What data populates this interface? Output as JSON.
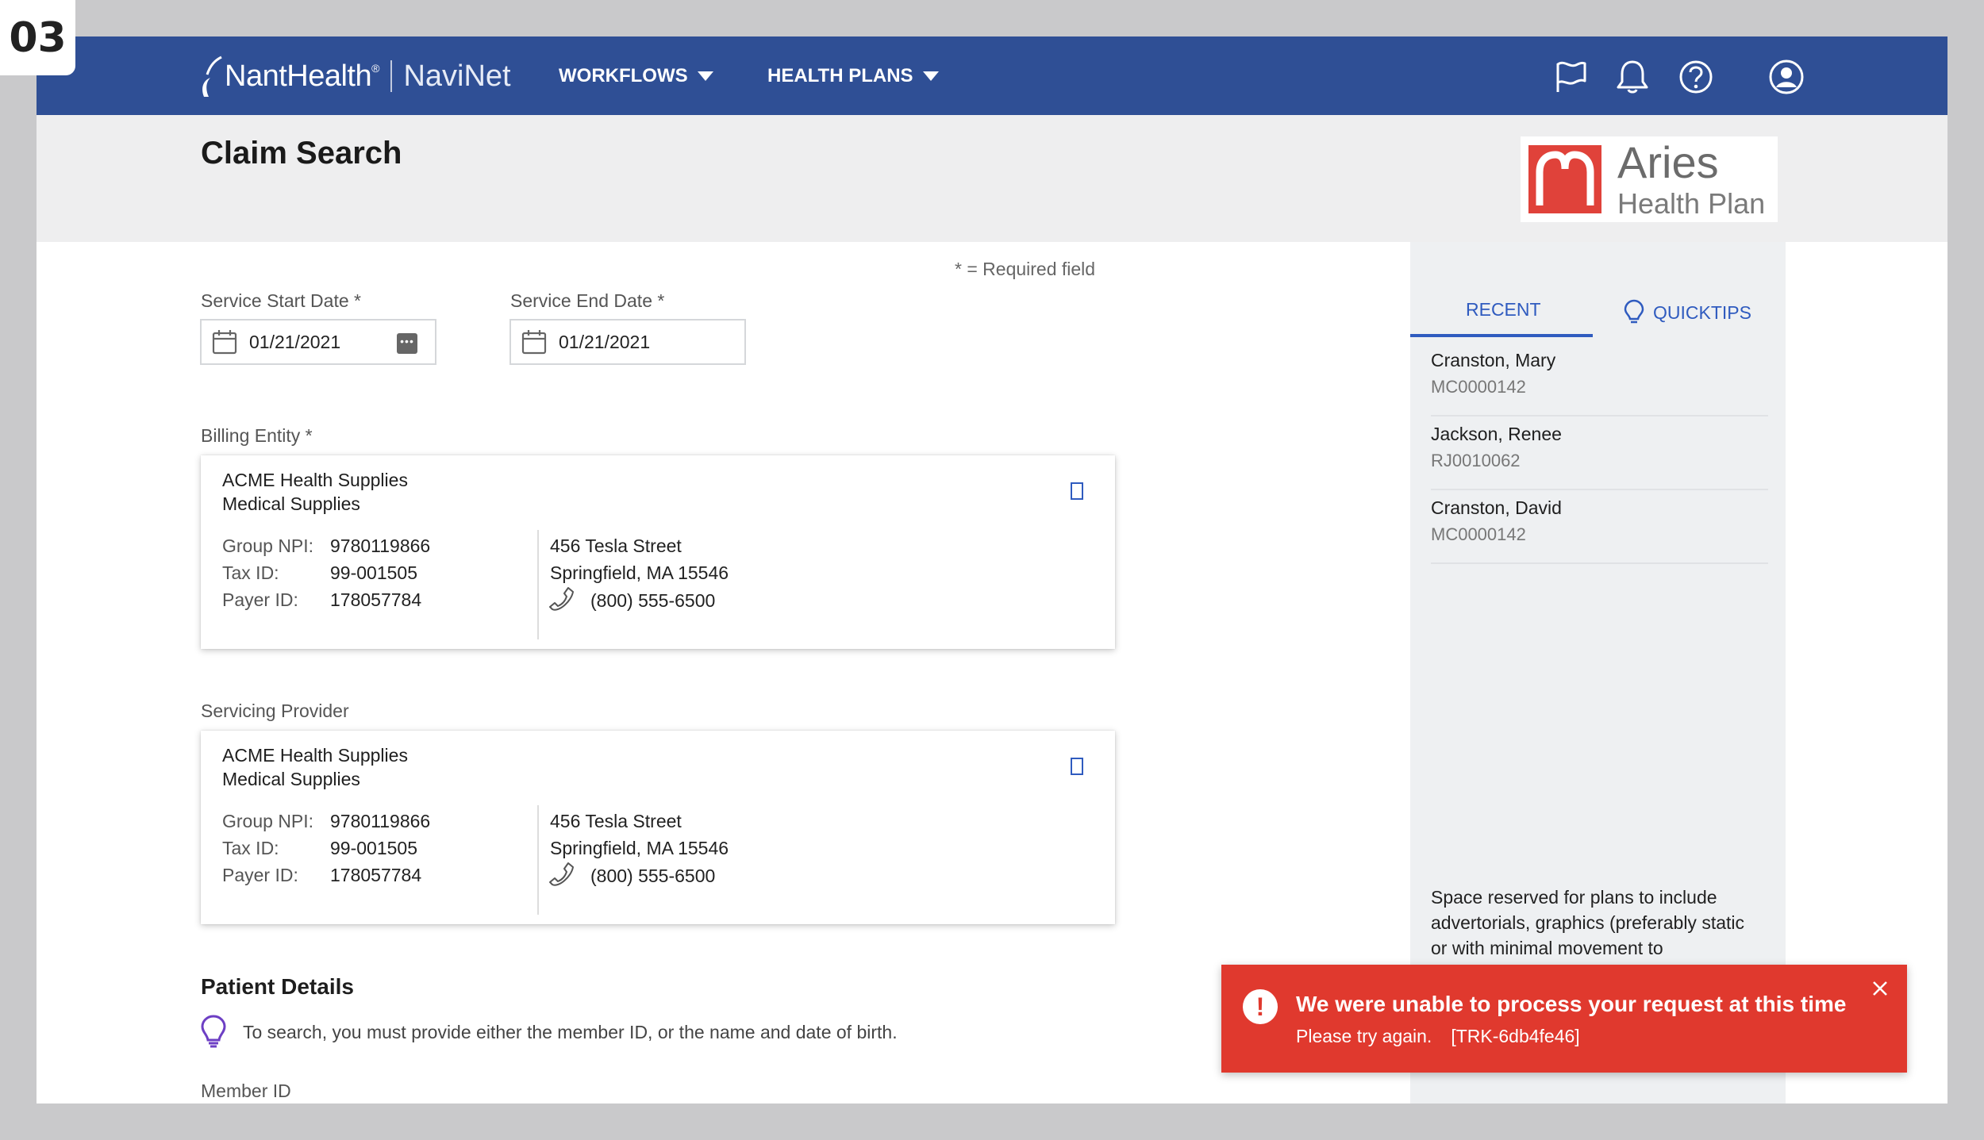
{
  "step_badge": "03",
  "header": {
    "brand": "NantHealth",
    "product": "NaviNet",
    "nav": [
      {
        "label": "WORKFLOWS"
      },
      {
        "label": "HEALTH PLANS"
      }
    ],
    "icons": [
      "flag-icon",
      "bell-icon",
      "help-icon",
      "user-icon"
    ],
    "bg_color": "#2f4f95"
  },
  "page": {
    "title": "Claim Search",
    "required_note": "* = Required field"
  },
  "plan_logo": {
    "name": "Aries",
    "subtitle": "Health Plan",
    "mark_color": "#e0423a"
  },
  "form": {
    "start_date": {
      "label": "Service Start Date *",
      "value": "01/21/2021"
    },
    "end_date": {
      "label": "Service End Date *",
      "value": "01/21/2021"
    },
    "billing_entity": {
      "label": "Billing Entity *",
      "name_line1": "ACME Health Supplies",
      "name_line2": "Medical Supplies",
      "group_npi_label": "Group NPI:",
      "group_npi": "9780119866",
      "tax_id_label": "Tax ID:",
      "tax_id": "99-001505",
      "payer_id_label": "Payer ID:",
      "payer_id": "178057784",
      "street": "456 Tesla Street",
      "city": "Springfield, MA 15546",
      "phone": "(800) 555-6500"
    },
    "servicing_provider": {
      "label": "Servicing Provider",
      "name_line1": "ACME Health Supplies",
      "name_line2": "Medical Supplies",
      "group_npi_label": "Group NPI:",
      "group_npi": "9780119866",
      "tax_id_label": "Tax ID:",
      "tax_id": "99-001505",
      "payer_id_label": "Payer ID:",
      "payer_id": "178057784",
      "street": "456 Tesla Street",
      "city": "Springfield, MA 15546",
      "phone": "(800) 555-6500"
    },
    "patient_details": {
      "title": "Patient Details",
      "hint": "To search, you must provide either the member ID, or the  name and date of birth.",
      "member_id_label": "Member ID"
    }
  },
  "right_panel": {
    "tabs": [
      {
        "label": "RECENT",
        "active": true
      },
      {
        "label": "QUICKTIPS",
        "active": false
      }
    ],
    "recent": [
      {
        "name": "Cranston, Mary",
        "id": "MC0000142"
      },
      {
        "name": "Jackson, Renee",
        "id": "RJ0010062"
      },
      {
        "name": "Cranston, David",
        "id": "MC0000142"
      }
    ],
    "reserved_text": "Space reserved for plans to include advertorials, graphics (preferably static or with minimal movement to"
  },
  "toast": {
    "title": "We were unable to process your request at this time",
    "message": "Please try again.",
    "code": "[TRK-6db4fe46]",
    "color": "#e0392e"
  }
}
